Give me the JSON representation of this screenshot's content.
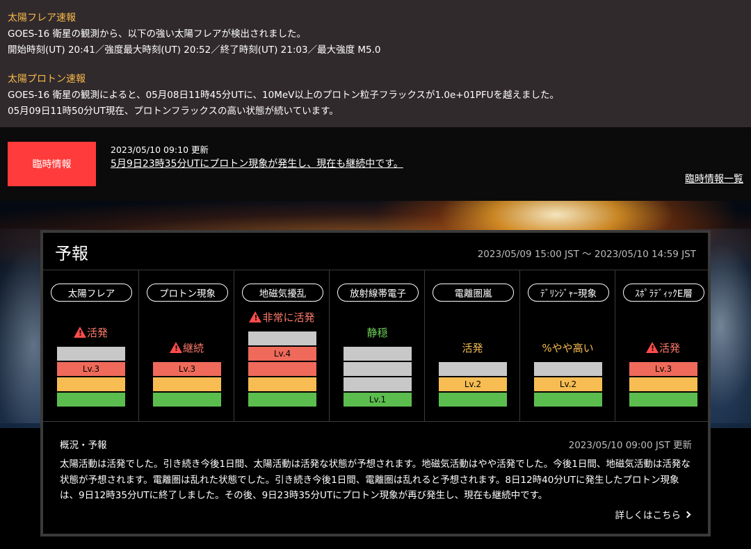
{
  "alerts": {
    "flare": {
      "title": "太陽フレア速報",
      "line1": "GOES-16 衛星の観測から、以下の強い太陽フレアが検出されました。",
      "line2": "開始時刻(UT) 20:41／強度最大時刻(UT) 20:52／終了時刻(UT) 21:03／最大強度 M5.0"
    },
    "proton": {
      "title": "太陽プロトン速報",
      "line1": "GOES-16 衛星の観測によると、05月08日11時45分UTに、10MeV以上のプロトン粒子フラックスが1.0e+01PFUを越えました。",
      "line2": "05月09日11時50分UT現在、プロトンフラックスの高い状態が続いています。"
    }
  },
  "notice": {
    "badge": "臨時情報",
    "date": "2023/05/10 09:10 更新",
    "link": "5月9日23時35分UTにプロトン現象が発生し、現在も継続中です。",
    "list_link": "臨時情報一覧"
  },
  "forecast": {
    "title": "予報",
    "period": "2023/05/09 15:00 JST 〜 2023/05/10 14:59 JST",
    "columns": [
      {
        "label": "太陽フレア",
        "status": "活発",
        "warn": true,
        "status_color": "#ff7a6a",
        "level": 3,
        "max_level": 4,
        "level_label": "Lv.3"
      },
      {
        "label": "プロトン現象",
        "status": "継続",
        "warn": true,
        "status_color": "#ff7a6a",
        "level": 3,
        "max_level": 3,
        "level_label": "Lv.3"
      },
      {
        "label": "地磁気擾乱",
        "status": "非常に活発",
        "warn": true,
        "status_color": "#ff7a6a",
        "level": 4,
        "max_level": 5,
        "level_label": "Lv.4"
      },
      {
        "label": "放射線帯電子",
        "status": "静穏",
        "warn": false,
        "status_color": "#6fcf5a",
        "level": 1,
        "max_level": 4,
        "level_label": "Lv.1"
      },
      {
        "label": "電離圏嵐",
        "status": "活発",
        "warn": false,
        "status_color": "#f7bd52",
        "level": 2,
        "max_level": 3,
        "level_label": "Lv.2"
      },
      {
        "label": "ﾃﾞﾘﾝｼﾞｬｰ現象",
        "status": "%やや高い",
        "warn": false,
        "status_color": "#f7bd52",
        "level": 2,
        "max_level": 3,
        "level_label": "Lv.2"
      },
      {
        "label": "ｽﾎﾟﾗﾃﾞｨｯｸE層",
        "status": "活発",
        "warn": true,
        "status_color": "#ff7a6a",
        "level": 3,
        "max_level": 3,
        "level_label": "Lv.3"
      }
    ],
    "summary": {
      "heading": "概況・予報",
      "updated": "2023/05/10 09:00 JST 更新",
      "text": "太陽活動は活発でした。引き続き今後1日間、太陽活動は活発な状態が予想されます。地磁気活動はやや活発でした。今後1日間、地磁気活動は活発な状態が予想されます。電離圏は乱れた状態でした。引き続き今後1日間、電離圏は乱れると予想されます。8日12時40分UTに発生したプロトン現象は、9日12時35分UTに終了しました。その後、9日23時35分UTにプロトン現象が再び発生し、現在も継続中です。",
      "more": "詳しくはこちら"
    }
  }
}
